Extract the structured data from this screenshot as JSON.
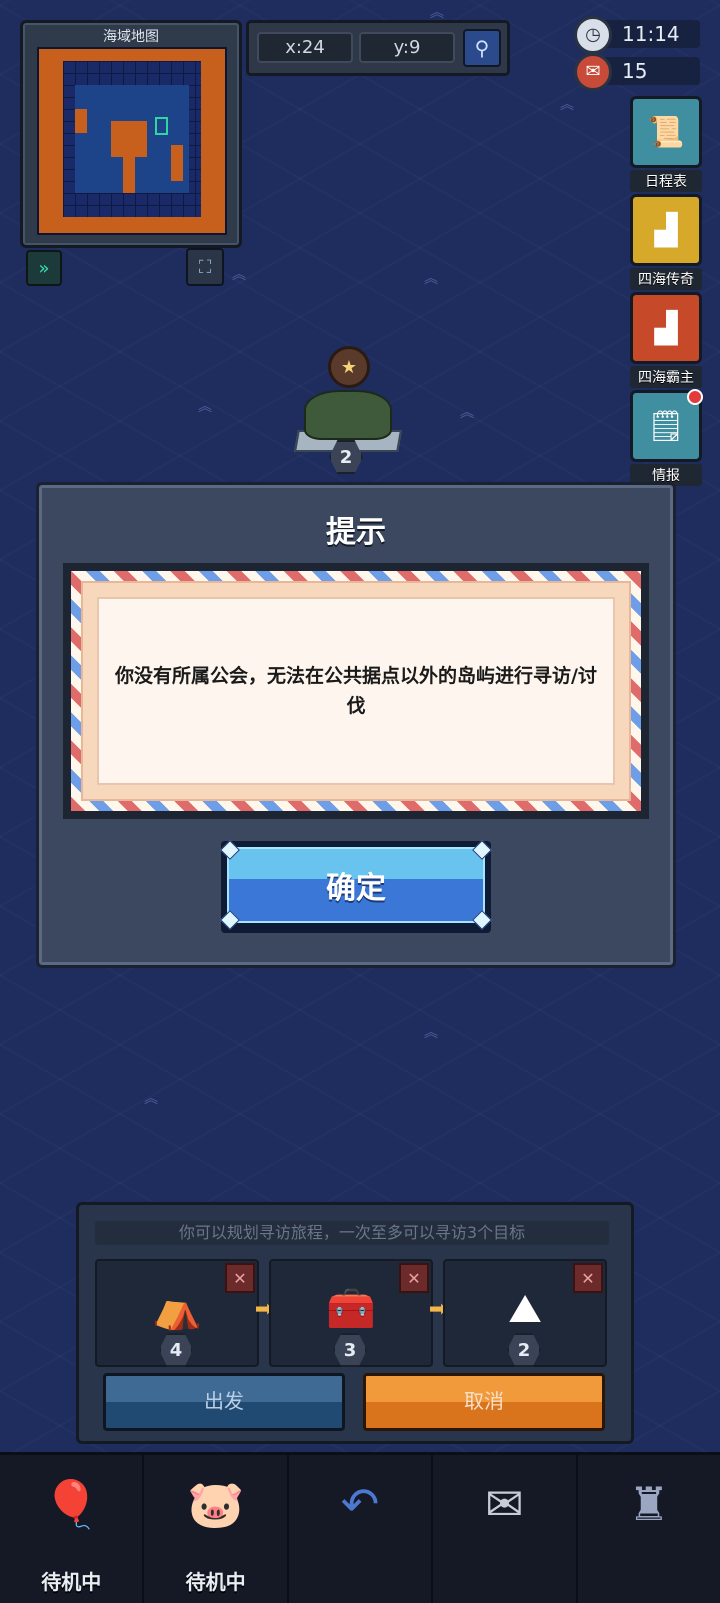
{
  "minimap": {
    "title": "海域地图",
    "icon": "sea-map"
  },
  "coords": {
    "x": "x:24",
    "y": "y:9",
    "search_icon": "magnifier-icon"
  },
  "hud": {
    "time": "11:14",
    "count": "15",
    "clock_icon": "clock-icon",
    "count_icon": "scroll-bundle-icon"
  },
  "side_buttons": [
    {
      "label": "日程表",
      "icon": "scroll-icon",
      "color": "#3f8fa0"
    },
    {
      "label": "四海传奇",
      "icon": "podium-icon",
      "color": "#d6a92a"
    },
    {
      "label": "四海霸主",
      "icon": "podium-icon",
      "color": "#c64a2a"
    },
    {
      "label": "情报",
      "icon": "documents-icon",
      "color": "#3f8fa0"
    }
  ],
  "island": {
    "level": "2"
  },
  "dialog": {
    "title": "提示",
    "message": "你没有所属公会，无法在公共据点以外的岛屿进行寻访/讨伐",
    "confirm_label": "确定"
  },
  "planner": {
    "hint": "你可以规划寻访旅程，一次至多可以寻访3个目标",
    "slots": [
      {
        "level": "4",
        "icon": "tent-icon"
      },
      {
        "level": "3",
        "icon": "treasure-chest-icon"
      },
      {
        "level": "2",
        "icon": "island-rock-icon"
      }
    ],
    "go_label": "出发",
    "cancel_label": "取消"
  },
  "bottom_nav": [
    {
      "label": "待机中",
      "icon": "balloon-icon"
    },
    {
      "label": "待机中",
      "icon": "pig-cannon-icon"
    },
    {
      "label": "",
      "icon": "return-arrow-icon"
    },
    {
      "label": "",
      "icon": "envelope-icon"
    },
    {
      "label": "",
      "icon": "castle-tower-icon"
    }
  ]
}
